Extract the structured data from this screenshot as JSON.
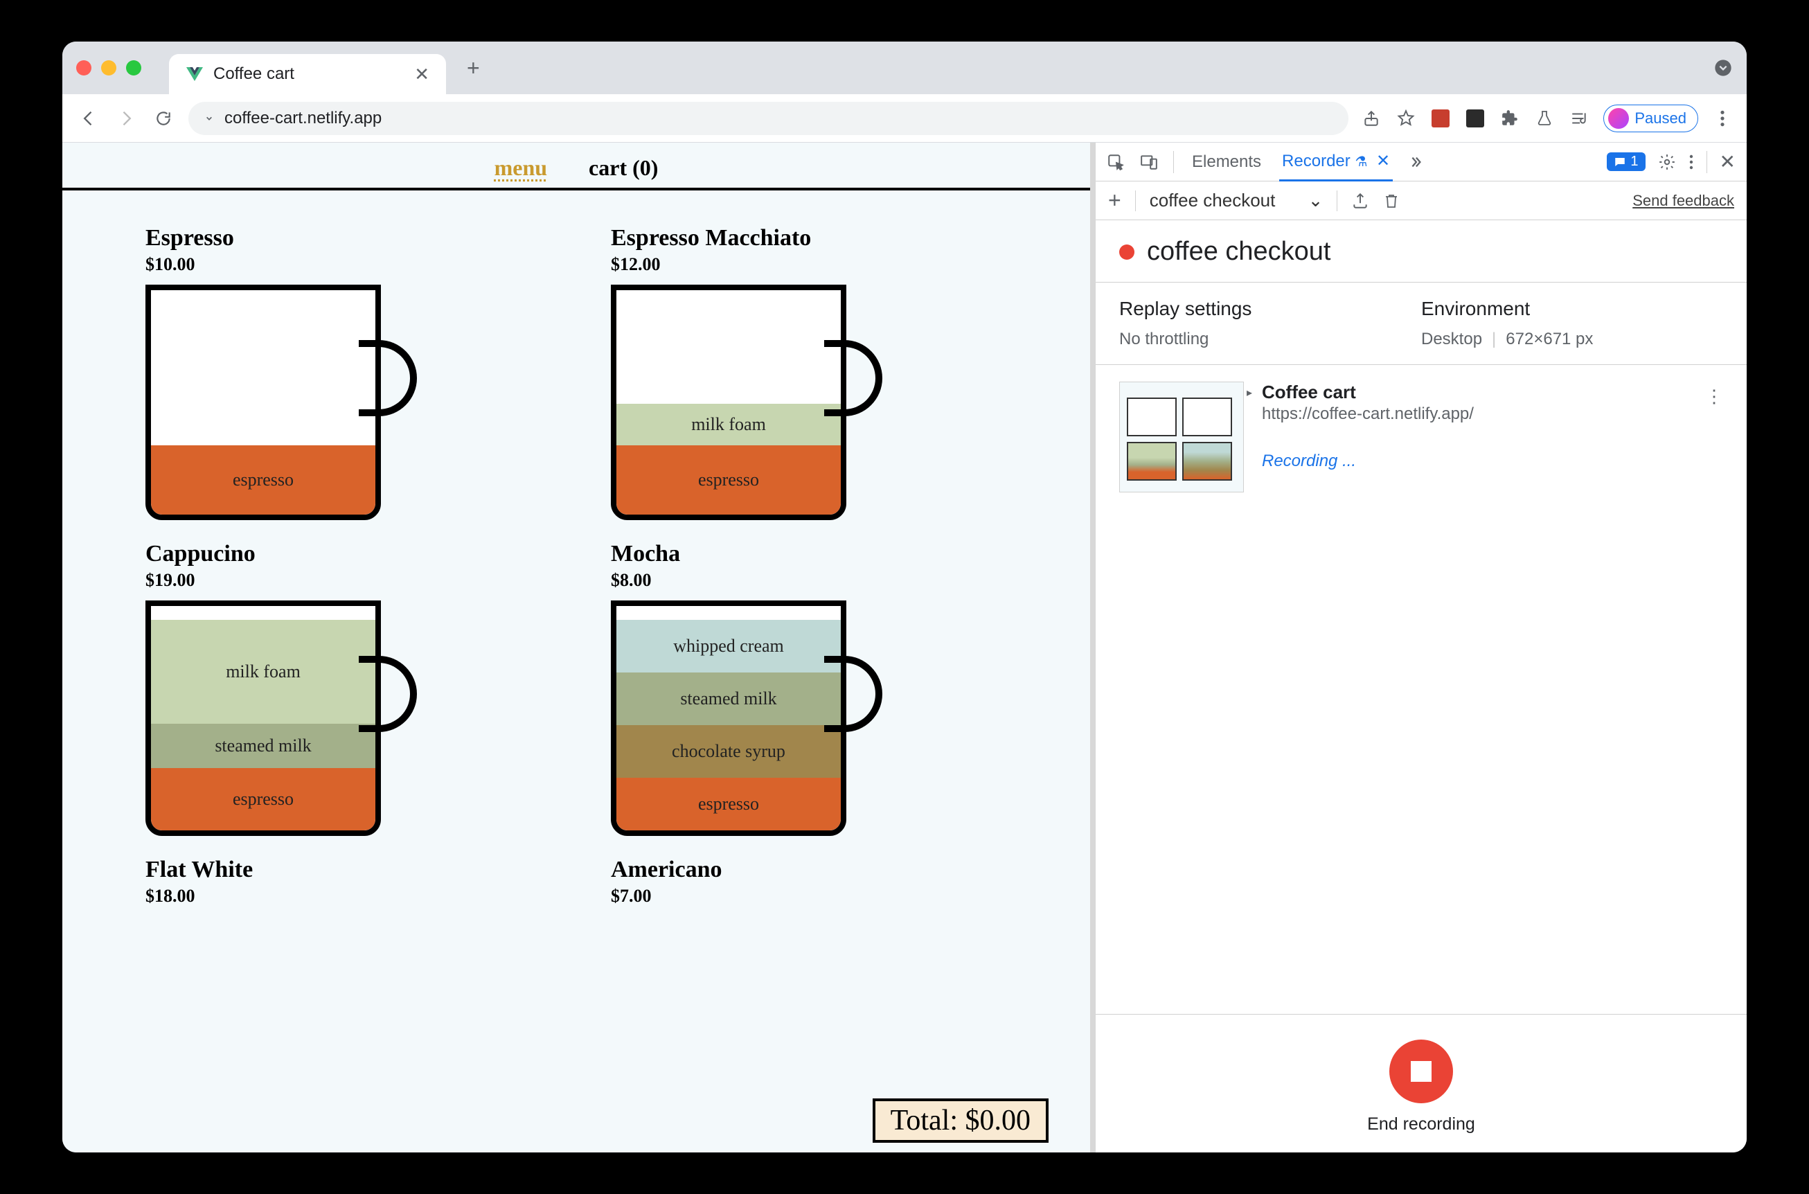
{
  "browser": {
    "tab_title": "Coffee cart",
    "url": "coffee-cart.netlify.app",
    "paused_label": "Paused"
  },
  "page": {
    "nav": {
      "menu": "menu",
      "cart": "cart (0)"
    },
    "items": [
      {
        "name": "Espresso",
        "price": "$10.00",
        "layers": [
          {
            "label": "espresso",
            "color": "#d9632b",
            "h": 100
          }
        ]
      },
      {
        "name": "Espresso Macchiato",
        "price": "$12.00",
        "layers": [
          {
            "label": "milk foam",
            "color": "#c7d6b0",
            "h": 60
          },
          {
            "label": "espresso",
            "color": "#d9632b",
            "h": 100
          }
        ]
      },
      {
        "name": "Cappucino",
        "price": "$19.00",
        "layers": [
          {
            "label": "milk foam",
            "color": "#c7d6b0",
            "h": 150
          },
          {
            "label": "steamed milk",
            "color": "#a3b08a",
            "h": 64
          },
          {
            "label": "espresso",
            "color": "#d9632b",
            "h": 90
          }
        ]
      },
      {
        "name": "Mocha",
        "price": "$8.00",
        "layers": [
          {
            "label": "whipped cream",
            "color": "#bfd9d6",
            "h": 76
          },
          {
            "label": "steamed milk",
            "color": "#a3b08a",
            "h": 76
          },
          {
            "label": "chocolate syrup",
            "color": "#a1864c",
            "h": 76
          },
          {
            "label": "espresso",
            "color": "#d9632b",
            "h": 76
          }
        ]
      },
      {
        "name": "Flat White",
        "price": "$18.00",
        "layers": []
      },
      {
        "name": "Americano",
        "price": "$7.00",
        "layers": []
      }
    ],
    "total_label": "Total: $0.00"
  },
  "devtools": {
    "tabs": {
      "elements": "Elements",
      "recorder": "Recorder"
    },
    "messages_count": "1",
    "toolbar": {
      "recording_name": "coffee checkout",
      "feedback": "Send feedback"
    },
    "header_title": "coffee checkout",
    "settings": {
      "replay_heading": "Replay settings",
      "replay_value": "No throttling",
      "env_heading": "Environment",
      "env_device": "Desktop",
      "env_dims": "672×671 px"
    },
    "step": {
      "title": "Coffee cart",
      "url": "https://coffee-cart.netlify.app/",
      "recording": "Recording ..."
    },
    "end_label": "End recording"
  }
}
